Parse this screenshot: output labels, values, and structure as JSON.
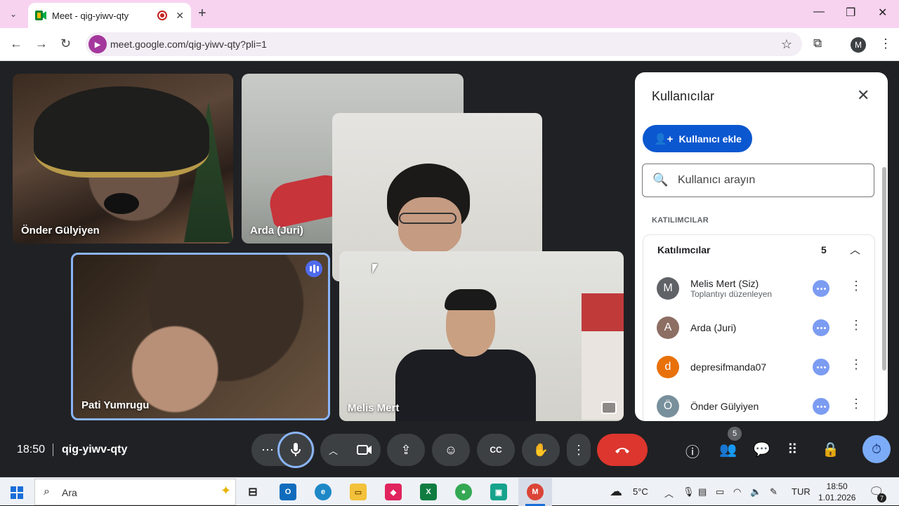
{
  "browser": {
    "tab_title": "Meet - qig-yiwv-qty",
    "new_tab_glyph": "+",
    "url": "meet.google.com/qig-yiwv-qty?pli=1",
    "profile_initial": "M",
    "accent": "#a4389c"
  },
  "tiles": [
    {
      "name": "Önder Gülyiyen"
    },
    {
      "name": "Arda (Juri)"
    },
    {
      "name": ""
    },
    {
      "name": "Pati Yumrugu"
    },
    {
      "name": "Melis Mert"
    }
  ],
  "panel": {
    "title": "Kullanıcılar",
    "add_button": "Kullanıcı ekle",
    "search_placeholder": "Kullanıcı arayın",
    "section_label": "KATILIMCILAR",
    "group_label": "Katılımcılar",
    "group_count": "5",
    "participants": [
      {
        "initial": "M",
        "name": "Melis Mert (Siz)",
        "role": "Toplantıyı düzenleyen",
        "color": "#5f6368"
      },
      {
        "initial": "A",
        "name": "Arda (Juri)",
        "role": "",
        "color": "#8d6e63"
      },
      {
        "initial": "d",
        "name": "depresifmanda07",
        "role": "",
        "color": "#e8710a"
      },
      {
        "initial": "Ö",
        "name": "Önder Gülyiyen",
        "role": "",
        "color": "#78909c"
      }
    ]
  },
  "controls": {
    "time": "18:50",
    "meeting_code": "qig-yiwv-qty",
    "people_badge": "5",
    "colors": {
      "hangup": "#dc362e",
      "mic_ring": "#8ab4f8",
      "timer": "#7cacf8"
    }
  },
  "taskbar": {
    "search_placeholder": "Ara",
    "weather": "5°C",
    "language": "TUR",
    "time": "18:50",
    "date": "1.01.2026",
    "notification_count": "7"
  }
}
